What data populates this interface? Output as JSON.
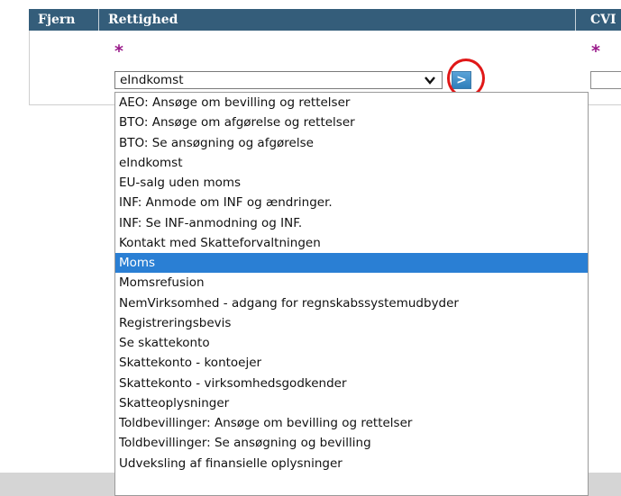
{
  "header": {
    "col_remove": "Fjern",
    "col_right": "Rettighed",
    "col_cvr": "CVI"
  },
  "form": {
    "required_mark": "*",
    "selected_value": "eIndkomst",
    "go_label": ">"
  },
  "dropdown": {
    "selected_index": 8,
    "options": [
      "AEO: Ansøge om bevilling og rettelser",
      "BTO: Ansøge om afgørelse og rettelser",
      "BTO: Se ansøgning og afgørelse",
      "eIndkomst",
      "EU-salg uden moms",
      "INF: Anmode om INF og ændringer.",
      "INF: Se INF-anmodning og INF.",
      "Kontakt med Skatteforvaltningen",
      "Moms",
      "Momsrefusion",
      "NemVirksomhed - adgang for regnskabssystemudbyder",
      "Registreringsbevis",
      "Se skattekonto",
      "Skattekonto - kontoejer",
      "Skattekonto - virksomhedsgodkender",
      "Skatteoplysninger",
      "Toldbevillinger: Ansøge om bevilling og rettelser",
      "Toldbevillinger: Se ansøgning og bevilling",
      "Udveksling af finansielle oplysninger"
    ]
  },
  "colors": {
    "header_bg": "#345d7a",
    "highlight": "#2a7fd4",
    "required": "#9a1a8a",
    "annotation": "#e01818"
  }
}
